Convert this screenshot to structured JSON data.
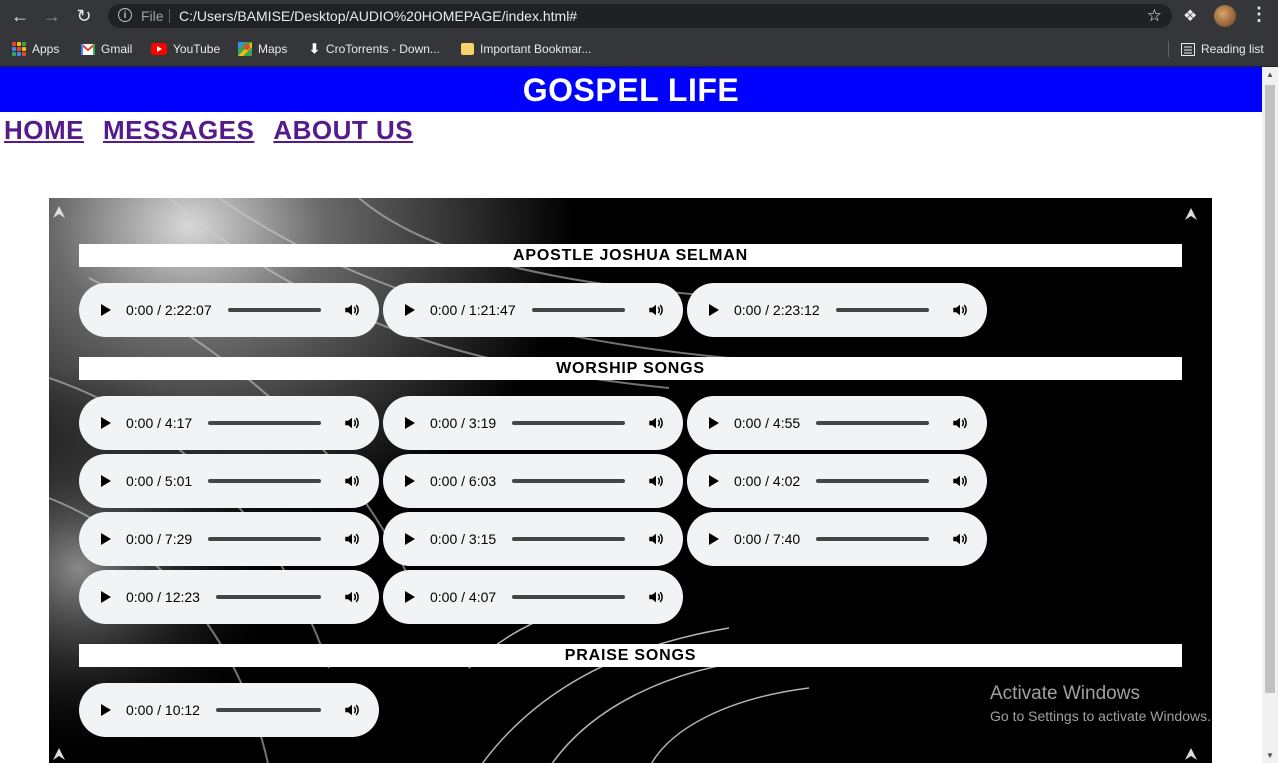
{
  "browser": {
    "omnibox": {
      "scheme_label": "File",
      "url": "C:/Users/BAMISE/Desktop/AUDIO%20HOMEPAGE/index.html#"
    },
    "bookmarks": [
      {
        "label": "Apps",
        "icon": "apps-grid-icon"
      },
      {
        "label": "Gmail",
        "icon": "gmail-icon"
      },
      {
        "label": "YouTube",
        "icon": "youtube-icon"
      },
      {
        "label": "Maps",
        "icon": "maps-icon"
      },
      {
        "label": "CroTorrents - Down...",
        "icon": "download-arrow-icon"
      },
      {
        "label": "Important Bookmar...",
        "icon": "folder-icon"
      }
    ],
    "reading_list_label": "Reading list"
  },
  "site": {
    "title": "GOSPEL LIFE",
    "header_color": "#0000ff",
    "nav": [
      {
        "label": "HOME"
      },
      {
        "label": "MESSAGES"
      },
      {
        "label": "ABOUT US"
      }
    ],
    "sections": [
      {
        "heading": "APOSTLE JOSHUA SELMAN",
        "players": [
          {
            "time": "0:00 / 2:22:07"
          },
          {
            "time": "0:00 / 1:21:47"
          },
          {
            "time": "0:00 / 2:23:12"
          }
        ]
      },
      {
        "heading": "WORSHIP SONGS",
        "players": [
          {
            "time": "0:00 / 4:17"
          },
          {
            "time": "0:00 / 3:19"
          },
          {
            "time": "0:00 / 4:55"
          },
          {
            "time": "0:00 / 5:01"
          },
          {
            "time": "0:00 / 6:03"
          },
          {
            "time": "0:00 / 4:02"
          },
          {
            "time": "0:00 / 7:29"
          },
          {
            "time": "0:00 / 3:15"
          },
          {
            "time": "0:00 / 7:40"
          },
          {
            "time": "0:00 / 12:23"
          },
          {
            "time": "0:00 / 4:07"
          }
        ]
      },
      {
        "heading": "PRAISE SONGS",
        "players": [
          {
            "time": "0:00 / 10:12"
          }
        ]
      }
    ]
  },
  "os_overlay": {
    "title": "Activate Windows",
    "subtitle": "Go to Settings to activate Windows."
  }
}
